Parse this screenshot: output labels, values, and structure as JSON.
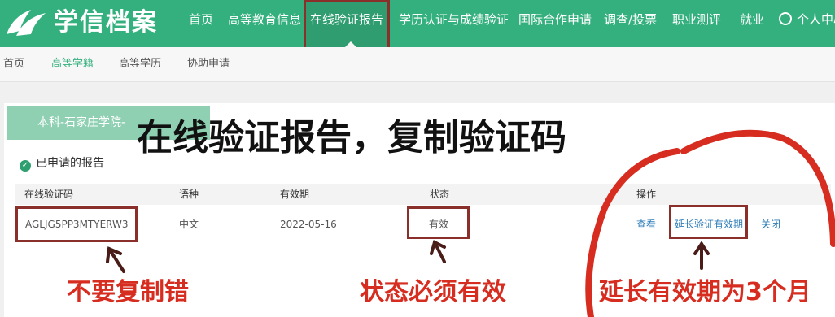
{
  "header": {
    "brand": "学信档案",
    "nav": [
      "首页",
      "高等教育信息",
      "在线验证报告",
      "学历认证与成绩验证",
      "国际合作申请",
      "调查/投票",
      "职业测评",
      "就业"
    ],
    "active_nav": "在线验证报告",
    "user_center": "个人中心"
  },
  "subnav": {
    "items": [
      "首页",
      "高等学籍",
      "高等学历",
      "协助申请"
    ],
    "active": "高等学籍"
  },
  "school_tab": "本科-石家庄学院-",
  "headline": "在线验证报告，复制验证码",
  "applied_title": "已申请的报告",
  "table": {
    "headers": [
      "在线验证码",
      "语种",
      "有效期",
      "状态",
      "操作"
    ],
    "row": {
      "code": "AGLJG5PP3MTYERW3",
      "language": "中文",
      "expiry": "2022-05-16",
      "status": "有效",
      "actions": [
        "查看",
        "延长验证有效期",
        "关闭"
      ]
    }
  },
  "annotations": {
    "copy_warning": "不要复制错",
    "status_note": "状态必须有效",
    "extend_note": "延长有效期为3个月"
  },
  "colors": {
    "header_green": "#34b07e",
    "annotation_red": "#d62d20",
    "box_red": "#8a2f2a"
  }
}
